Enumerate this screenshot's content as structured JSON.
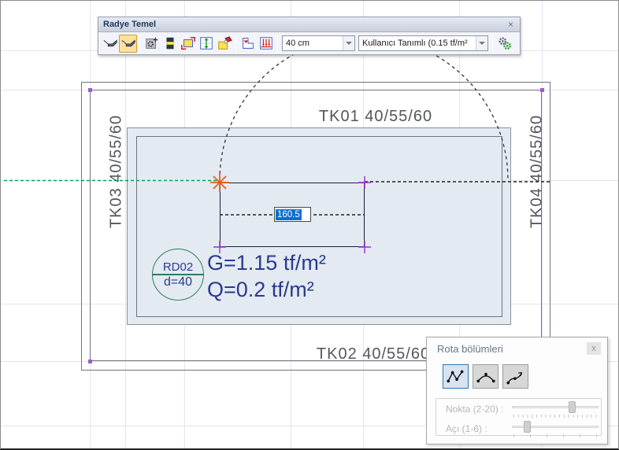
{
  "toolbar": {
    "title": "Radye Temel",
    "close": "×",
    "icons": [
      "raft-foundation",
      "raft-foundation-active",
      "foundation-settings",
      "foundation-section",
      "slab-corner",
      "stretch-vertical",
      "edit-slab",
      "drop-panel",
      "soil-load",
      "parameters-gears"
    ],
    "thickness_combo": {
      "value": "40 cm"
    },
    "soil_combo": {
      "value": "Kullanıcı Tanımlı (0.15 tf/m²"
    }
  },
  "canvas": {
    "beam_labels": {
      "top": "TK01 40/55/60",
      "bottom": "TK02 40/55/60",
      "left": "TK03 40/55/60",
      "right": "TK04 40/55/60"
    },
    "slab_tag": {
      "name": "RD02",
      "thickness": "d=40"
    },
    "load_g": "G=1.15 tf/m²",
    "load_q": "Q=0.2 tf/m²",
    "dimension_value": "160.5"
  },
  "route_panel": {
    "title": "Rota bölümleri",
    "close": "x",
    "modes": [
      "polyline",
      "arc",
      "spline"
    ],
    "point_slider": {
      "label": "Nokta (2-20) :",
      "percent": 70
    },
    "angle_slider": {
      "label": "Açı (1-6) :",
      "percent": 18
    }
  },
  "colors": {
    "selection_blue": "#2e75b6",
    "load_text": "#2b3a8f",
    "beam_label": "#55565e",
    "green_axis": "#00a651",
    "purple_marker": "#9b30d0",
    "snap_marker": "#e65c1f",
    "tag_circle": "#2e7d5b",
    "dimension_selection": "#0a6fd4",
    "slab_fill": "#e3eaf2",
    "toolbar_selected_bg": "#fce0a0"
  }
}
